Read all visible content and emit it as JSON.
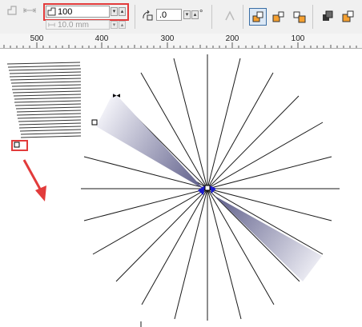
{
  "toolbar": {
    "steps_field": {
      "value": "100",
      "icon": "blend-steps-icon"
    },
    "spacing_field": {
      "value": "10.0 mm",
      "icon": "blend-spacing-icon"
    },
    "rotation_field": {
      "value": ".0",
      "icon": "blend-direction-icon"
    },
    "degree_symbol": "°",
    "icons": [
      "snap-icon",
      "spacing-icon",
      "loop-blend-icon",
      "direct-blend-icon",
      "clockwise-blend-icon",
      "counterclockwise-blend-icon",
      "object-color-acceleration-icon",
      "accelerate-sizes-icon"
    ]
  },
  "ruler": {
    "labels": [
      "500",
      "400",
      "300",
      "200",
      "100"
    ]
  },
  "canvas": {
    "colors": {
      "lines": "#1a1a1a",
      "blend_start": "#5c5c88",
      "blend_end": "#f2f2f8",
      "annotation": "#e23b3b",
      "handle": "#1a1acc"
    }
  }
}
